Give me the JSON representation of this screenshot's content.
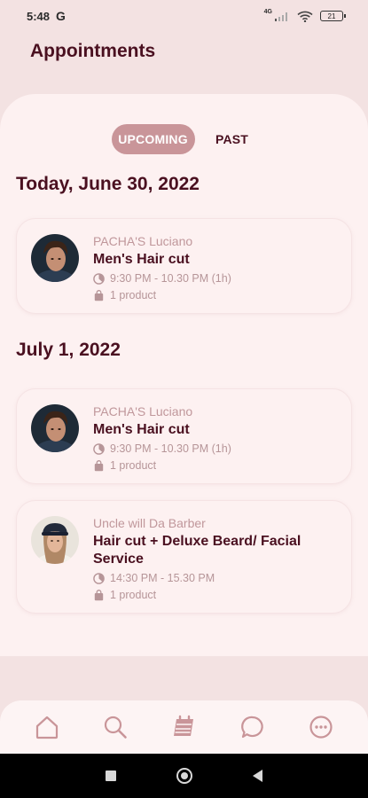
{
  "status_bar": {
    "time": "5:48",
    "g_label": "G",
    "network": "4G",
    "battery": "21"
  },
  "header": {
    "title": "Appointments"
  },
  "tabs": [
    {
      "label": "UPCOMING",
      "active": true
    },
    {
      "label": "PAST",
      "active": false
    }
  ],
  "sections": [
    {
      "title": "Today, June 30, 2022",
      "appointments": [
        {
          "shop": "PACHA'S Luciano",
          "service": "Men's Hair cut",
          "time": "9:30 PM - 10.30 PM (1h)",
          "products": "1 product"
        }
      ]
    },
    {
      "title": "July 1, 2022",
      "appointments": [
        {
          "shop": "PACHA'S Luciano",
          "service": "Men's Hair cut",
          "time": "9:30 PM - 10.30 PM (1h)",
          "products": "1 product"
        },
        {
          "shop": "Uncle will Da Barber",
          "service": "Hair cut + Deluxe Beard/ Facial Service",
          "time": "14:30 PM - 15.30 PM",
          "products": "1 product"
        }
      ]
    }
  ],
  "bottom_nav": [
    {
      "name": "home-icon"
    },
    {
      "name": "search-icon"
    },
    {
      "name": "calendar-icon",
      "active": true
    },
    {
      "name": "chat-icon"
    },
    {
      "name": "more-icon"
    }
  ],
  "colors": {
    "accent": "#c99599",
    "title": "#4a1020",
    "muted": "#b69598",
    "background": "#f3e2e2",
    "sheet": "#fdf1f1"
  }
}
